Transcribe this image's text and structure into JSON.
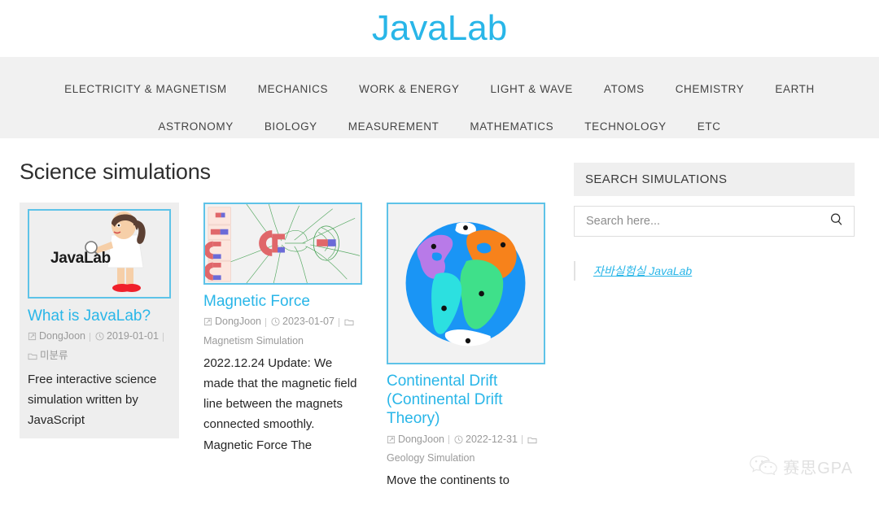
{
  "header": {
    "site_title": "JavaLab",
    "title_color": "#29b6e8"
  },
  "nav": {
    "row1": [
      {
        "label": "ELECTRICITY & MAGNETISM"
      },
      {
        "label": "MECHANICS"
      },
      {
        "label": "WORK & ENERGY"
      },
      {
        "label": "LIGHT & WAVE"
      },
      {
        "label": "ATOMS"
      },
      {
        "label": "CHEMISTRY"
      },
      {
        "label": "EARTH"
      }
    ],
    "row2": [
      {
        "label": "ASTRONOMY"
      },
      {
        "label": "BIOLOGY"
      },
      {
        "label": "MEASUREMENT"
      },
      {
        "label": "MATHEMATICS"
      },
      {
        "label": "TECHNOLOGY"
      },
      {
        "label": "ETC"
      }
    ]
  },
  "main": {
    "page_title": "Science simulations",
    "cards": [
      {
        "title": "What is JavaLab?",
        "author": "DongJoon",
        "date": "2019-01-01",
        "category": "미분류",
        "excerpt": "Free interactive science simulation written by JavaScript",
        "thumb_label": "JavaLab",
        "thumb_kind": "hero-girl",
        "featured": true
      },
      {
        "title": "Magnetic Force",
        "author": "DongJoon",
        "date": "2023-01-07",
        "category": "Magnetism Simulation",
        "excerpt": "2022.12.24 Update: We made that the magnetic field line between the magnets connected smoothly. Magnetic Force The",
        "thumb_kind": "magnetic-field",
        "featured": false
      },
      {
        "title": "Continental Drift (Continental Drift Theory)",
        "author": "DongJoon",
        "date": "2022-12-31",
        "category": "Geology Simulation",
        "excerpt": "Move the continents to",
        "thumb_kind": "globe",
        "featured": false
      }
    ]
  },
  "sidebar": {
    "widget_title": "SEARCH SIMULATIONS",
    "search_value": "",
    "search_placeholder": "Search here...",
    "quote_link": "자바실험실 JavaLab"
  },
  "watermark": {
    "text": "赛思GPA"
  }
}
